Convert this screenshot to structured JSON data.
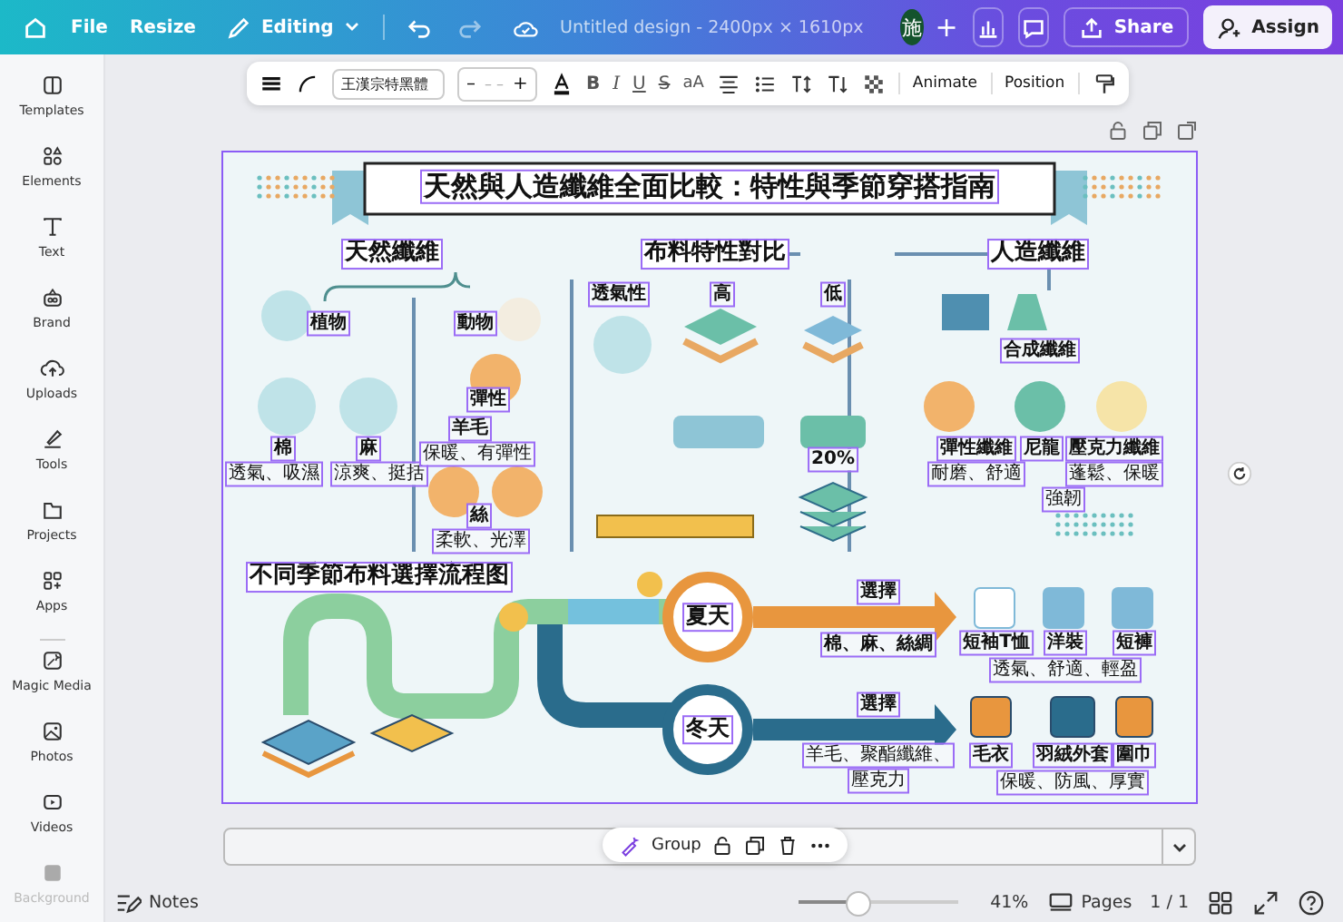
{
  "topbar": {
    "menu": [
      "File",
      "Resize"
    ],
    "mode": "Editing",
    "title": "Untitled design - 2400px × 1610px",
    "avatar": "施",
    "plus": "+",
    "share": "Share",
    "assign": "Assign"
  },
  "toolbar": {
    "font": "王漢宗特黑體",
    "size_minus": "–",
    "size_value": "– –",
    "size_plus": "+",
    "formats": [
      "B",
      "I",
      "U",
      "S",
      "aA"
    ],
    "buttons": [
      "Animate",
      "Position"
    ]
  },
  "sidebar": [
    "Templates",
    "Elements",
    "Text",
    "Brand",
    "Uploads",
    "Tools",
    "Projects",
    "Apps",
    "Magic Media",
    "Photos",
    "Videos",
    "Background"
  ],
  "canvas": {
    "texts": [
      {
        "text": "天然與人造纖維全面比較：特性與季節穿搭指南",
        "kind": "title"
      },
      {
        "text": "天然纖維",
        "kind": "heading"
      },
      {
        "text": "布料特性對比",
        "kind": "heading"
      },
      {
        "text": "人造纖維",
        "kind": "heading"
      },
      {
        "text": "植物",
        "kind": "label"
      },
      {
        "text": "動物",
        "kind": "label"
      },
      {
        "text": "透氣性",
        "kind": "label"
      },
      {
        "text": "高",
        "kind": "label"
      },
      {
        "text": "低",
        "kind": "label"
      },
      {
        "text": "合成纖維",
        "kind": "label"
      },
      {
        "text": "棉",
        "kind": "label"
      },
      {
        "text": "透氣、吸濕",
        "kind": "note"
      },
      {
        "text": "麻",
        "kind": "label"
      },
      {
        "text": "涼爽、挺括",
        "kind": "note"
      },
      {
        "text": "彈性",
        "kind": "label"
      },
      {
        "text": "羊毛",
        "kind": "label"
      },
      {
        "text": "保暖、有彈性",
        "kind": "note"
      },
      {
        "text": "絲",
        "kind": "label"
      },
      {
        "text": "柔軟、光澤",
        "kind": "note"
      },
      {
        "text": "20%",
        "kind": "label"
      },
      {
        "text": "彈性纖維",
        "kind": "label"
      },
      {
        "text": "耐磨、舒適",
        "kind": "note"
      },
      {
        "text": "尼龍",
        "kind": "label"
      },
      {
        "text": "強韌",
        "kind": "note"
      },
      {
        "text": "壓克力纖維",
        "kind": "label"
      },
      {
        "text": "蓬鬆、保暖",
        "kind": "note"
      },
      {
        "text": "不同季節布料選擇流程图",
        "kind": "heading"
      },
      {
        "text": "夏天",
        "kind": "season"
      },
      {
        "text": "冬天",
        "kind": "season"
      },
      {
        "text": "選擇",
        "kind": "label"
      },
      {
        "text": "選擇",
        "kind": "label"
      },
      {
        "text": "棉、麻、絲綢",
        "kind": "label"
      },
      {
        "text": "短袖T恤",
        "kind": "label"
      },
      {
        "text": "洋裝",
        "kind": "label"
      },
      {
        "text": "短褲",
        "kind": "label"
      },
      {
        "text": "透氣、舒適、輕盈",
        "kind": "note"
      },
      {
        "text": "羊毛、聚酯纖維、",
        "kind": "note"
      },
      {
        "text": "壓克力",
        "kind": "note"
      },
      {
        "text": "毛衣",
        "kind": "label"
      },
      {
        "text": "羽絨外套",
        "kind": "label"
      },
      {
        "text": "圍巾",
        "kind": "label"
      },
      {
        "text": "保暖、防風、厚實",
        "kind": "note"
      }
    ]
  },
  "group_toolbar": {
    "label": "Group"
  },
  "bottom": {
    "notes": "Notes",
    "zoom": {
      "level": 0.37,
      "reading": "41%"
    },
    "pages": "Pages",
    "page_count": "1 / 1"
  }
}
